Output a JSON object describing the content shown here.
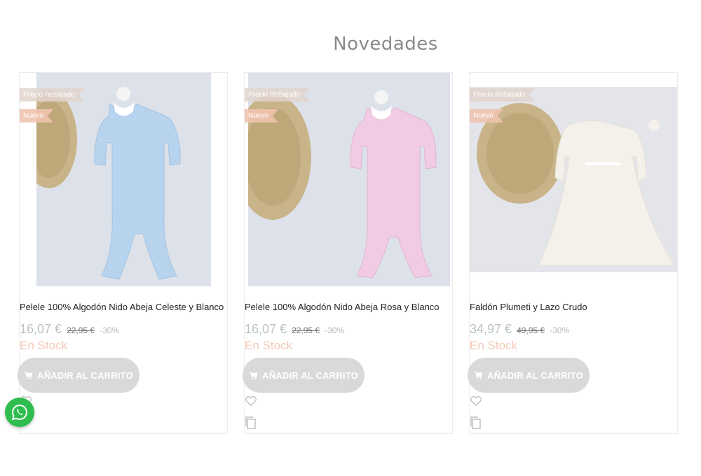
{
  "section": {
    "title": "Novedades"
  },
  "products": [
    {
      "badge_sale": "Precio Rebajado",
      "badge_new": "Nuevo",
      "title": "Pelele 100% Algodón Nido Abeja Celeste y Blanco",
      "price": "16,07 €",
      "old_price": "22,95 €",
      "discount": "-30%",
      "stock": "En Stock",
      "cart_label": "AÑADIR AL CARRITO",
      "garment_color": "#b7d3ee"
    },
    {
      "badge_sale": "Precio Rebajado",
      "badge_new": "Nuevo",
      "title": "Pelele 100% Algodón Nido Abeja Rosa y Blanco",
      "price": "16,07 €",
      "old_price": "22,95 €",
      "discount": "-30%",
      "stock": "En Stock",
      "cart_label": "AÑADIR AL CARRITO",
      "garment_color": "#f0cbe3"
    },
    {
      "badge_sale": "Precio Rebajado",
      "badge_new": "Nuevo",
      "title": "Faldón Plumeti y Lazo Crudo",
      "price": "34,97 €",
      "old_price": "49,95 €",
      "discount": "-30%",
      "stock": "En Stock",
      "cart_label": "AÑADIR AL CARRITO",
      "garment_color": "#f4f1ea"
    }
  ],
  "colors": {
    "price": "#b9c4c2",
    "stock": "#f3c9b8",
    "button_bg": "#d9d9d9",
    "whatsapp": "#2ebd4e"
  }
}
